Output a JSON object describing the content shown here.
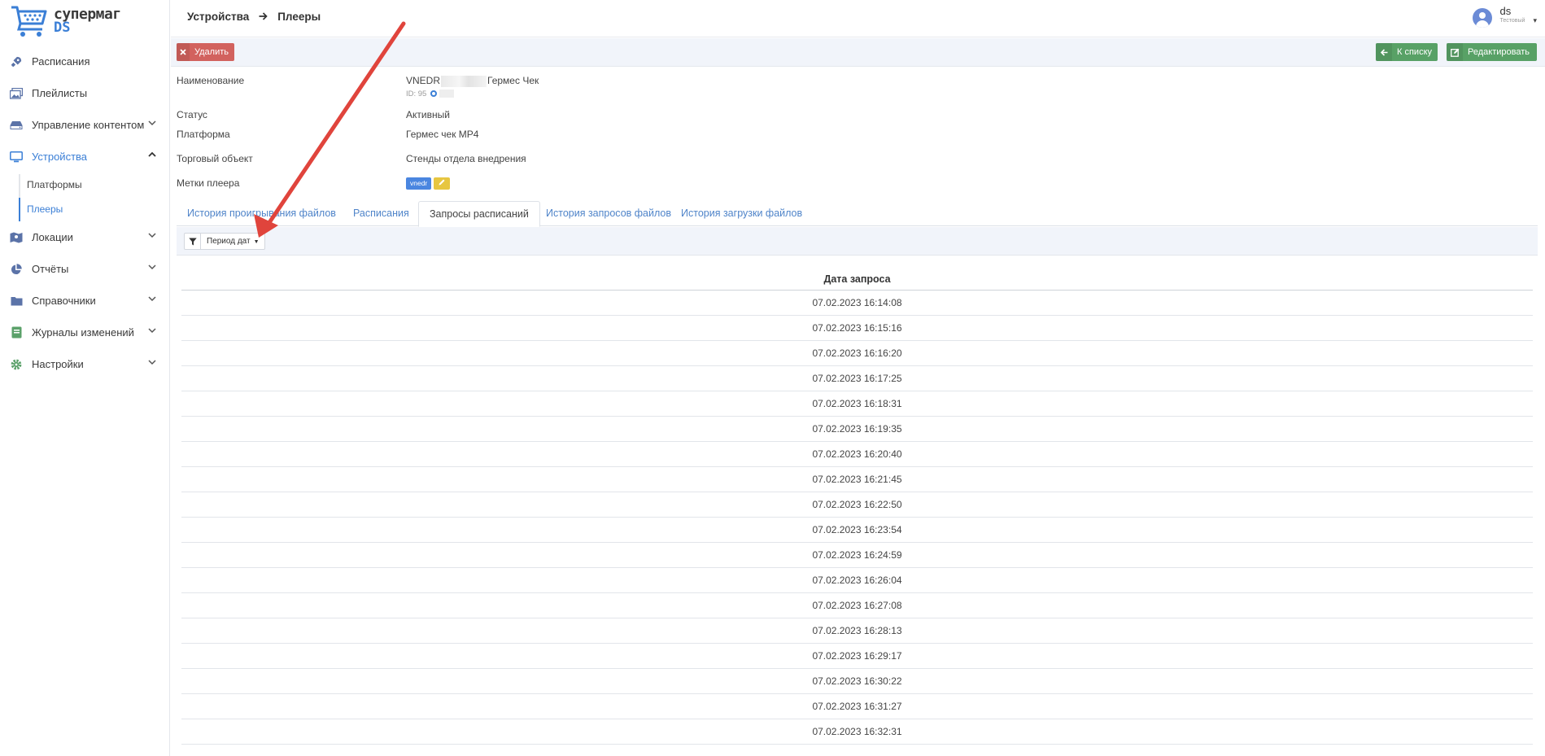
{
  "brand": {
    "line1": "супермаг",
    "line2": "DS"
  },
  "sidebar": {
    "items": [
      {
        "label": "Расписания",
        "icon": "rocket-icon",
        "chevron": false
      },
      {
        "label": "Плейлисты",
        "icon": "images-icon",
        "chevron": false
      },
      {
        "label": "Управление контентом",
        "icon": "hdd-icon",
        "chevron": true
      },
      {
        "label": "Устройства",
        "icon": "monitor-icon",
        "chevron": true,
        "active": true,
        "expanded": true
      },
      {
        "label": "Локации",
        "icon": "map-icon",
        "chevron": true
      },
      {
        "label": "Отчёты",
        "icon": "pie-chart-icon",
        "chevron": true
      },
      {
        "label": "Справочники",
        "icon": "folder-icon",
        "chevron": true
      },
      {
        "label": "Журналы изменений",
        "icon": "journal-icon",
        "chevron": true
      },
      {
        "label": "Настройки",
        "icon": "gear-icon",
        "chevron": true
      }
    ],
    "subitems": [
      {
        "label": "Платформы"
      },
      {
        "label": "Плееры",
        "active": true
      }
    ]
  },
  "header": {
    "breadcrumb": [
      "Устройства",
      "Плееры"
    ],
    "user": {
      "name": "ds",
      "role": "Тестовый"
    }
  },
  "toolbar": {
    "delete_label": "Удалить",
    "back_label": "К списку",
    "edit_label": "Редактировать",
    "colors": {
      "danger": "#d2625e",
      "success": "#58a166",
      "accent": "#3b7fd6"
    }
  },
  "details": {
    "name_label": "Наименование",
    "name_prefix": "VNEDR",
    "name_suffix": "Гермес Чек",
    "id_text": "ID: 95",
    "status_label": "Статус",
    "status_value": "Активный",
    "platform_label": "Платформа",
    "platform_value": "Гермес чек MP4",
    "object_label": "Торговый объект",
    "object_value": "Стенды отдела внедрения",
    "tags_label": "Метки плеера",
    "tag_value": "vnedr"
  },
  "tabs": [
    {
      "label": "История проигрывания файлов"
    },
    {
      "label": "Расписания"
    },
    {
      "label": "Запросы расписаний",
      "active": true
    },
    {
      "label": "История запросов файлов"
    },
    {
      "label": "История загрузки файлов"
    }
  ],
  "filter": {
    "label": "Период дат"
  },
  "table": {
    "header": "Дата запроса",
    "rows": [
      "07.02.2023 16:14:08",
      "07.02.2023 16:15:16",
      "07.02.2023 16:16:20",
      "07.02.2023 16:17:25",
      "07.02.2023 16:18:31",
      "07.02.2023 16:19:35",
      "07.02.2023 16:20:40",
      "07.02.2023 16:21:45",
      "07.02.2023 16:22:50",
      "07.02.2023 16:23:54",
      "07.02.2023 16:24:59",
      "07.02.2023 16:26:04",
      "07.02.2023 16:27:08",
      "07.02.2023 16:28:13",
      "07.02.2023 16:29:17",
      "07.02.2023 16:30:22",
      "07.02.2023 16:31:27",
      "07.02.2023 16:32:31"
    ]
  }
}
